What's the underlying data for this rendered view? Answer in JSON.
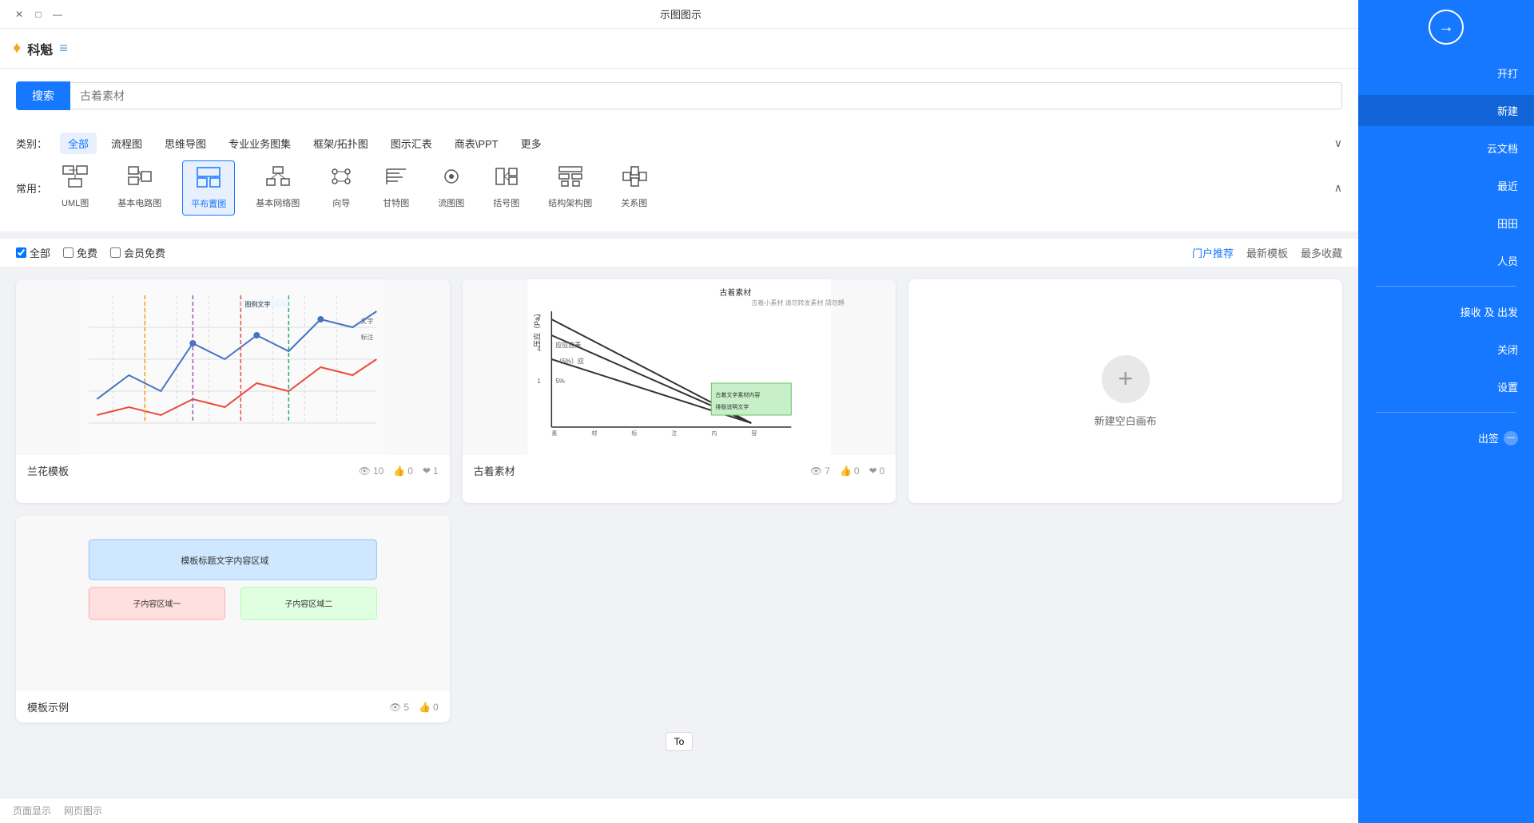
{
  "titleBar": {
    "title": "示图图示",
    "closeBtn": "✕",
    "maxBtn": "□",
    "minBtn": "—"
  },
  "logoBar": {
    "appName": "科魁",
    "logoIcon": "♦",
    "docIcon": "≡"
  },
  "searchBar": {
    "searchBtnLabel": "搜索",
    "placeholder": "古着素材"
  },
  "categoryFilter": {
    "label": "类别：",
    "allLabel": "全部",
    "tags": [
      "全部",
      "流程图",
      "思维导图",
      "专业业务图集",
      "框架/拓扑图",
      "图示汇表",
      "商表\\PPT",
      "更多"
    ],
    "activeTag": "全部",
    "toggleLabel": "∨"
  },
  "typeFilter": {
    "label": "常用：",
    "expandLabel": "∧",
    "items": [
      {
        "id": "uml",
        "label": "UML图",
        "icon": "⊞"
      },
      {
        "id": "basic-circuit",
        "label": "基本电路图",
        "icon": "⊟"
      },
      {
        "id": "flat-layout",
        "label": "平布置图",
        "icon": "▦"
      },
      {
        "id": "basic-network",
        "label": "基本网络图",
        "icon": "⊡"
      },
      {
        "id": "direction",
        "label": "向导",
        "icon": "◈"
      },
      {
        "id": "gantt",
        "label": "甘特图",
        "icon": "☰"
      },
      {
        "id": "flow",
        "label": "流图图",
        "icon": "⊙"
      },
      {
        "id": "bracket",
        "label": "括号图",
        "icon": "⊞"
      },
      {
        "id": "struct-chart",
        "label": "结构架构图",
        "icon": "⊟"
      },
      {
        "id": "relation",
        "label": "关系图",
        "icon": "⊡"
      }
    ],
    "activeItem": "flat-layout"
  },
  "filterOptions": {
    "allLabel": "全部",
    "freeLabel": "免费",
    "memberLabel": "会员免费",
    "allChecked": true,
    "freeChecked": false,
    "memberChecked": false,
    "sortOptions": [
      {
        "label": "门户推荐",
        "active": true
      },
      {
        "label": "最新模板",
        "active": false
      },
      {
        "label": "最多收藏",
        "active": false
      }
    ]
  },
  "cards": [
    {
      "id": 1,
      "type": "chart",
      "title": "兰花模板",
      "views": 10,
      "likes": 0,
      "favorites": 1
    },
    {
      "id": 2,
      "type": "chart2",
      "title": "古着素材",
      "subtitle": "古着素材",
      "views": 7,
      "likes": 0,
      "favorites": 0
    },
    {
      "id": 3,
      "type": "new",
      "title": "新建空白画布"
    }
  ],
  "sidebar": {
    "arrowIcon": "→",
    "items": [
      {
        "id": "open",
        "label": "开打",
        "active": false
      },
      {
        "id": "new-doc",
        "label": "新建",
        "active": true
      },
      {
        "id": "cloud-file",
        "label": "云文档",
        "active": false
      },
      {
        "id": "recent",
        "label": "最近",
        "active": false
      },
      {
        "id": "template",
        "label": "田田",
        "active": false
      },
      {
        "id": "mine",
        "label": "人员",
        "active": false
      },
      {
        "id": "share-receive",
        "label": "接收 及 出发",
        "active": false
      },
      {
        "id": "close",
        "label": "关闭",
        "active": false
      },
      {
        "id": "setting",
        "label": "设置",
        "active": false
      }
    ],
    "logout": {
      "label": "出签",
      "icon": "—"
    }
  },
  "bottomBar": {
    "items": [
      "页面显示",
      "网页图示"
    ]
  },
  "pagination": {
    "prevLabel": "To",
    "items": []
  }
}
